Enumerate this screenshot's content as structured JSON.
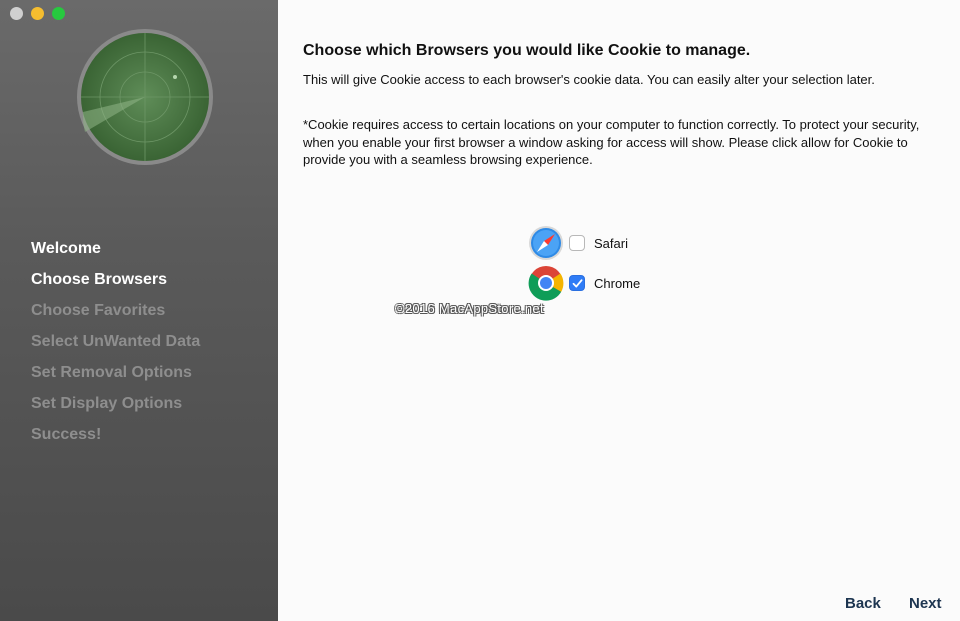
{
  "window": {
    "traffic_lights": [
      "close",
      "minimize",
      "maximize"
    ]
  },
  "sidebar": {
    "logo_icon": "radar-icon",
    "steps": [
      {
        "label": "Welcome",
        "state": "active"
      },
      {
        "label": "Choose Browsers",
        "state": "active"
      },
      {
        "label": "Choose Favorites",
        "state": "inactive"
      },
      {
        "label": "Select UnWanted Data",
        "state": "inactive"
      },
      {
        "label": "Set Removal Options",
        "state": "inactive"
      },
      {
        "label": "Set Display Options",
        "state": "inactive"
      },
      {
        "label": "Success!",
        "state": "inactive"
      }
    ]
  },
  "main": {
    "title": "Choose which Browsers you would like Cookie to manage.",
    "description": "This will give Cookie access to each browser's cookie data. You can easily alter your selection later.",
    "note": "*Cookie requires access to certain locations on your computer to function correctly. To protect your security, when you enable your first browser a window asking for access will show. Please click allow for Cookie to provide you with a seamless browsing experience.",
    "browsers": [
      {
        "name": "Safari",
        "checked": false,
        "icon": "safari-icon"
      },
      {
        "name": "Chrome",
        "checked": true,
        "icon": "chrome-icon"
      }
    ],
    "watermark": "©2016 MacAppStore.net"
  },
  "footer": {
    "back_label": "Back",
    "next_label": "Next"
  },
  "colors": {
    "accent": "#2f7cf6",
    "sidebar_bg": "#5a5a5a",
    "active_step": "#ffffff",
    "inactive_step": "#8e8e8e"
  }
}
